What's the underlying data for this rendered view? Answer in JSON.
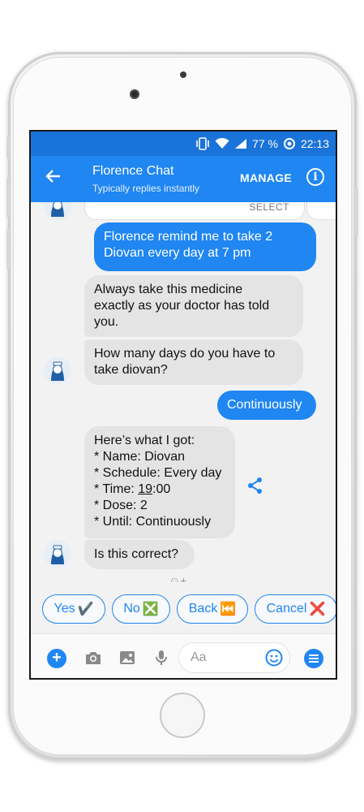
{
  "status_bar": {
    "battery": "77 %",
    "time": "22:13"
  },
  "header": {
    "title": "Florence Chat",
    "subtitle": "Typically replies instantly",
    "manage": "MANAGE"
  },
  "previous_card": {
    "label": "SELECT"
  },
  "messages": [
    {
      "from": "user",
      "lines": [
        "Florence remind me to take 2",
        "Diovan every day at 7 pm"
      ]
    },
    {
      "from": "bot",
      "lines": [
        "Always take this medicine",
        "exactly as your doctor has told",
        "you."
      ]
    },
    {
      "from": "bot",
      "lines": [
        "How many days do you have to",
        "take diovan?"
      ]
    },
    {
      "from": "user",
      "lines": [
        "Continuously"
      ]
    },
    {
      "from": "bot",
      "lines": [
        "Here’s what I got:",
        "* Name: Diovan",
        "* Schedule: Every day",
        "* Time: 19:00",
        "* Dose: 2",
        "* Until: Continuously"
      ]
    },
    {
      "from": "bot",
      "lines": [
        "Is this correct?"
      ]
    }
  ],
  "quick_replies": [
    {
      "label": "Yes",
      "emoji": "✔️"
    },
    {
      "label": "No",
      "emoji": "❎"
    },
    {
      "label": "Back",
      "emoji": "⏮️"
    },
    {
      "label": "Cancel",
      "emoji": "❌"
    }
  ],
  "composer": {
    "placeholder": "Aa"
  },
  "colors": {
    "accent": "#1f86f2",
    "status_bar": "#1a73d9",
    "bot_bubble": "#e4e4e4"
  },
  "icons": [
    "back-arrow-icon",
    "info-icon",
    "share-icon",
    "plus-icon",
    "camera-icon",
    "image-icon",
    "microphone-icon",
    "emoji-icon",
    "menu-icon"
  ]
}
